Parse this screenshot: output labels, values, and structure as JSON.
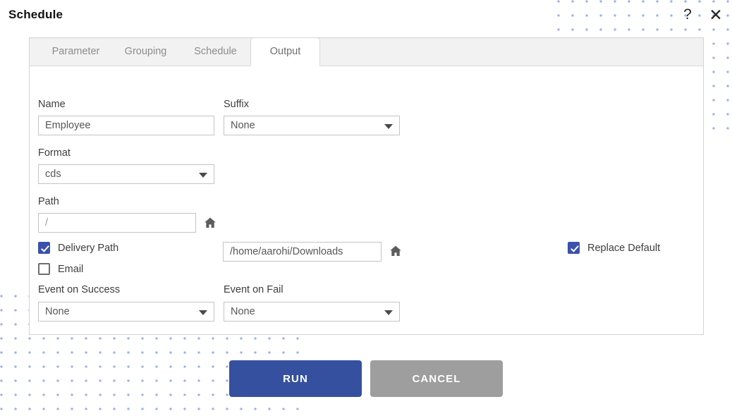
{
  "window": {
    "title": "Schedule",
    "help_icon": "question-mark-icon",
    "help_label": "?",
    "close_icon": "close-icon",
    "close_label": "✕"
  },
  "tabs": [
    {
      "label": "Parameter",
      "active": false
    },
    {
      "label": "Grouping",
      "active": false
    },
    {
      "label": "Schedule",
      "active": false
    },
    {
      "label": "Output",
      "active": true
    }
  ],
  "form": {
    "name": {
      "label": "Name",
      "value": "Employee",
      "placeholder": "Employee"
    },
    "suffix": {
      "label": "Suffix",
      "value": "None",
      "options": [
        "None"
      ]
    },
    "format": {
      "label": "Format",
      "value": "cds",
      "options": [
        "cds"
      ]
    },
    "path": {
      "label": "Path",
      "value": "/",
      "placeholder": "/",
      "home_icon": "home-icon"
    },
    "delivery_path": {
      "label": "Delivery Path",
      "checked": true,
      "value": "/home/aarohi/Downloads",
      "placeholder": "/home/aarohi/Downloads",
      "home_icon": "home-icon"
    },
    "email": {
      "label": "Email",
      "checked": false
    },
    "replace_default": {
      "label": "Replace Default",
      "checked": true
    },
    "event_on_success": {
      "label": "Event on Success",
      "value": "None",
      "options": [
        "None"
      ]
    },
    "event_on_fail": {
      "label": "Event on Fail",
      "value": "None",
      "options": [
        "None"
      ]
    }
  },
  "footer": {
    "run_label": "RUN",
    "cancel_label": "CANCEL"
  },
  "colors": {
    "accent": "#35509e",
    "checkbox_checked": "#3b51ac",
    "cancel": "#9e9e9e",
    "panel_border": "#d3d3d3",
    "tab_bar_bg": "#f2f2f2",
    "dot_pattern": "#a3b0e8"
  }
}
